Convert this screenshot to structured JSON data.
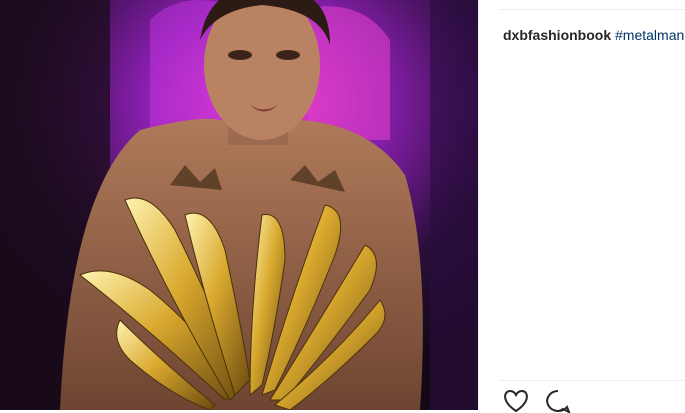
{
  "post": {
    "username": "dxbfashionbook",
    "hashtag": "#metalmania"
  },
  "icons": {
    "like": "heart-icon",
    "comment": "comment-bubble-icon"
  },
  "colors": {
    "hashtag": "#003569",
    "text": "#262626",
    "divider": "#efefef"
  }
}
